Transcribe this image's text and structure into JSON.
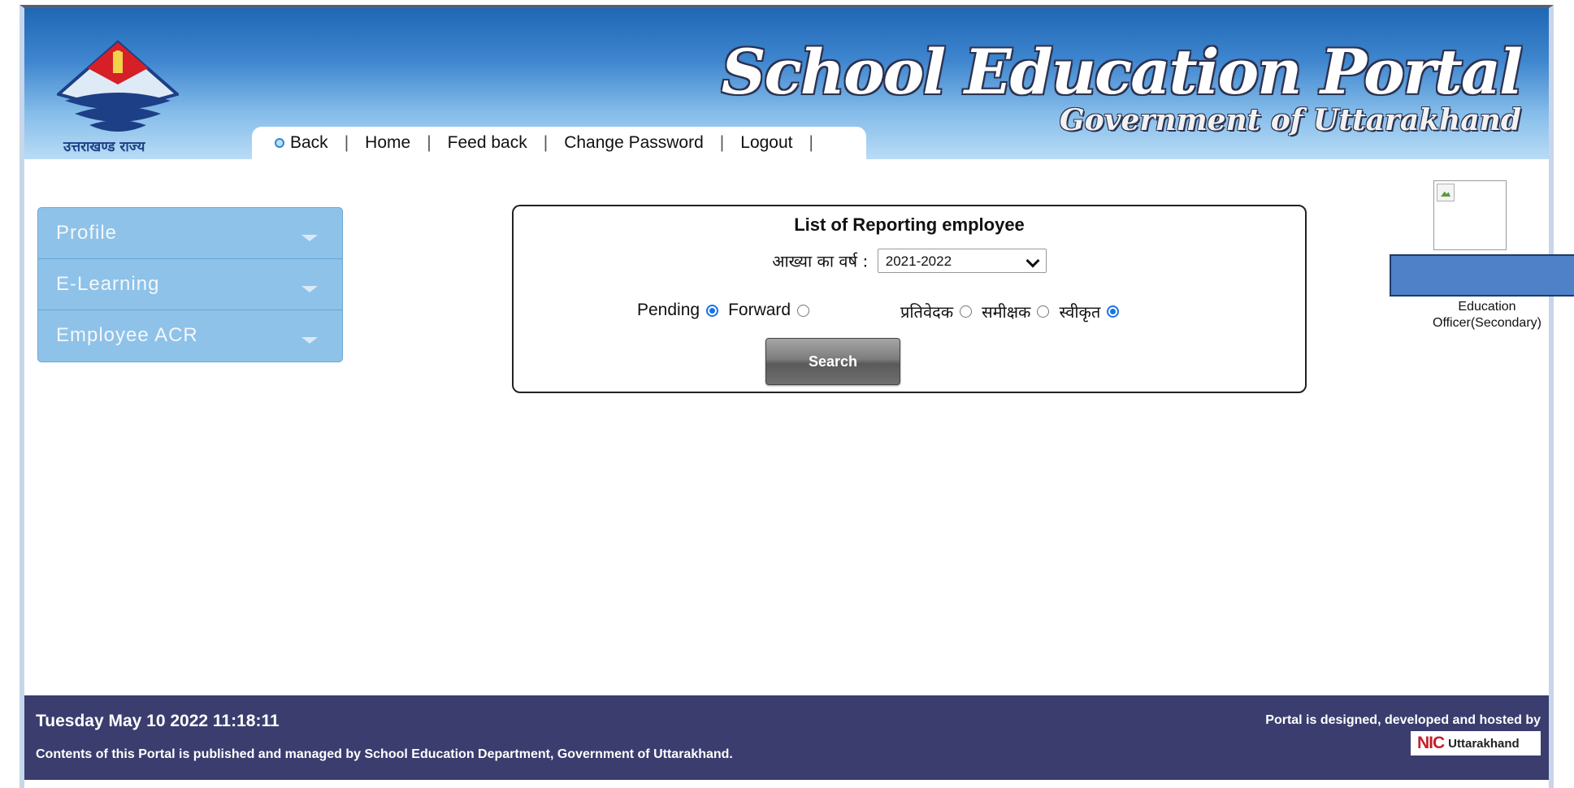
{
  "header": {
    "emblem_caption": "उत्तराखण्ड राज्य",
    "portal_title": "School Education Portal",
    "portal_subtitle": "Government of Uttarakhand"
  },
  "topnav": {
    "back": "Back",
    "home": "Home",
    "feedback": "Feed back",
    "change_password": "Change Password",
    "logout": "Logout",
    "separator": "|"
  },
  "sidebar": {
    "items": [
      {
        "label": "Profile"
      },
      {
        "label": "E-Learning"
      },
      {
        "label": "Employee ACR"
      }
    ]
  },
  "panel": {
    "title": "List of Reporting employee",
    "year_label": "आख्या का वर्ष :",
    "year_value": "2021-2022",
    "status_radios": [
      {
        "label": "Pending",
        "checked": true
      },
      {
        "label": "Forward",
        "checked": false
      }
    ],
    "role_radios": [
      {
        "label": "प्रतिवेदक",
        "checked": false
      },
      {
        "label": "समीक्षक",
        "checked": false
      },
      {
        "label": "स्वीकृत",
        "checked": true
      }
    ],
    "search_label": "Search"
  },
  "user": {
    "role": "Education Officer(Secondary)"
  },
  "footer": {
    "datetime": "Tuesday May 10 2022 11:18:11",
    "contents_note": "Contents of this Portal is published and managed by School Education Department, Government of Uttarakhand.",
    "hosted_by": "Portal is designed, developed and hosted by",
    "nic_logo": "NIC",
    "nic_region": "Uttarakhand"
  },
  "colors": {
    "header_top": "#1f67b4",
    "header_bottom": "#b9dcf6",
    "sidebar": "#8ec2e8",
    "footer": "#3a3d6e",
    "radio_accent": "#1a73e8"
  }
}
